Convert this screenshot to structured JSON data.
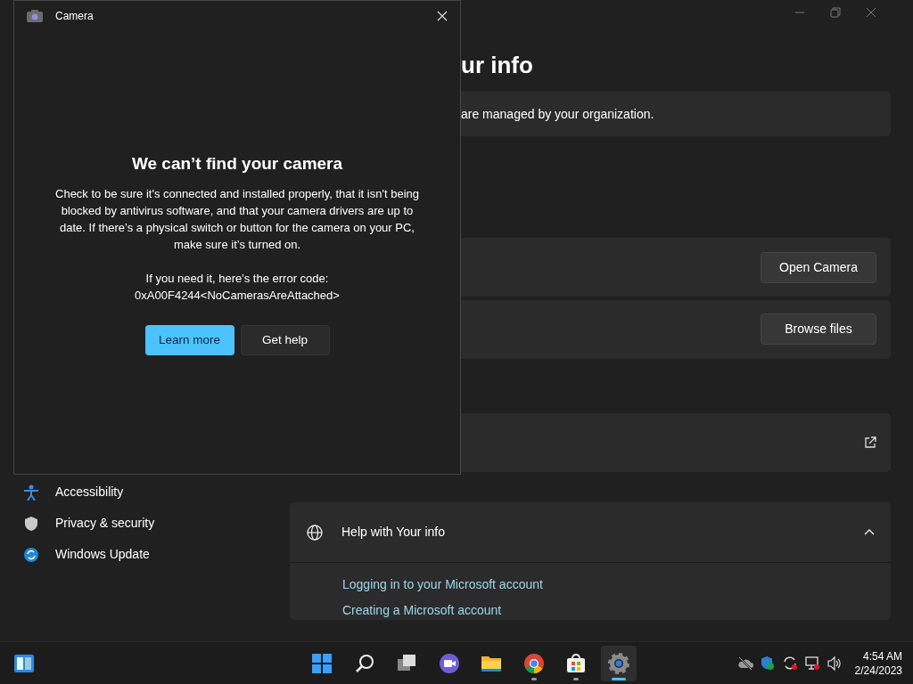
{
  "settings": {
    "sidebar": {
      "items": [
        {
          "label": "Accessibility",
          "kind": "accessibility"
        },
        {
          "label": "Privacy & security",
          "kind": "privacy"
        },
        {
          "label": "Windows Update",
          "kind": "update"
        }
      ]
    },
    "heading": "ur info",
    "notice": "are managed by your organization.",
    "rows": [
      {
        "kind": "button",
        "button": "Open Camera"
      },
      {
        "kind": "button",
        "button": "Browse files"
      },
      {
        "kind": "external-link"
      }
    ],
    "help": {
      "title": "Help with Your info",
      "expanded": true,
      "links": [
        "Logging in to your Microsoft account",
        "Creating a Microsoft account"
      ]
    }
  },
  "camera_dialog": {
    "title": "Camera",
    "heading": "We can’t find your camera",
    "message": "Check to be sure it's connected and installed properly, that it isn't being blocked by antivirus software, and that your camera drivers are up to date. If there’s a physical switch or button for the camera on your PC, make sure it’s turned on.",
    "error_label": "If you need it, here's the error code:",
    "error_code": "0xA00F4244<NoCamerasAreAttached>",
    "buttons": [
      {
        "label": "Learn more",
        "kind": "primary"
      },
      {
        "label": "Get help",
        "kind": "secondary"
      }
    ]
  },
  "taskbar": {
    "apps": [
      {
        "kind": "start",
        "running": false,
        "selected": false
      },
      {
        "kind": "search",
        "running": false,
        "selected": false
      },
      {
        "kind": "taskview",
        "running": false,
        "selected": false
      },
      {
        "kind": "chat",
        "running": false,
        "selected": false
      },
      {
        "kind": "explorer",
        "running": false,
        "selected": false
      },
      {
        "kind": "chrome",
        "running": true,
        "selected": false
      },
      {
        "kind": "store",
        "running": true,
        "selected": false
      },
      {
        "kind": "settings",
        "running": true,
        "selected": true
      }
    ],
    "time": "4:54 AM",
    "date": "2/24/2023"
  }
}
